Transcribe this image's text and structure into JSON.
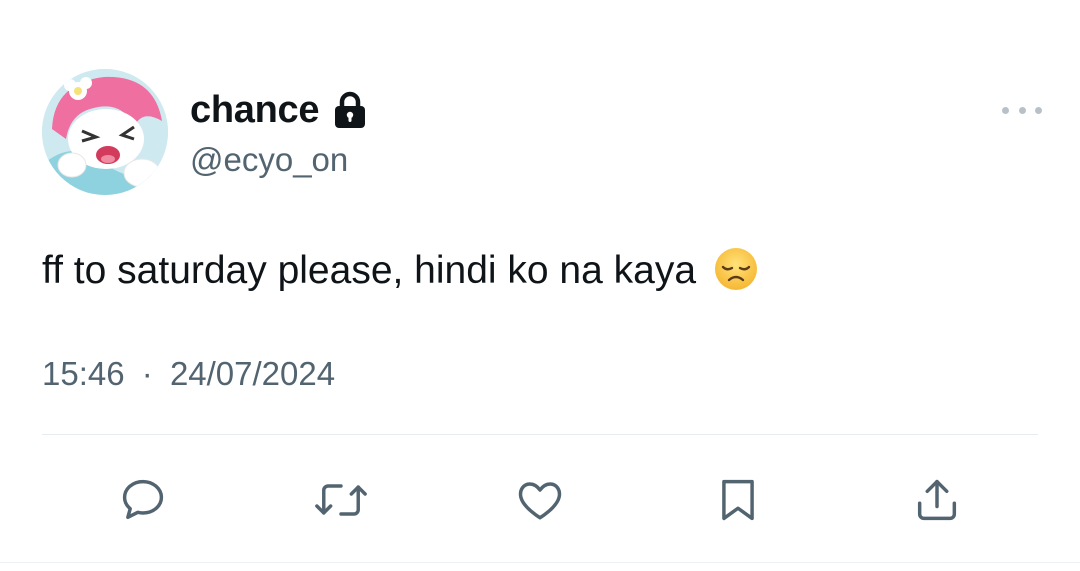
{
  "author": {
    "display_name": "chance",
    "handle": "@ecyo_on",
    "protected": true,
    "avatar": "my-melody-avatar"
  },
  "tweet": {
    "text": "ff to saturday please, hindi ko na kaya",
    "emoji": "disappointed-face-emoji",
    "time": "15:46",
    "separator": "·",
    "date": "24/07/2024"
  },
  "actions": [
    {
      "name": "reply",
      "icon": "speech-bubble-icon"
    },
    {
      "name": "retweet",
      "icon": "retweet-arrows-icon"
    },
    {
      "name": "like",
      "icon": "heart-icon"
    },
    {
      "name": "bookmark",
      "icon": "bookmark-icon"
    },
    {
      "name": "share",
      "icon": "share-upload-icon"
    }
  ],
  "colors": {
    "text_primary": "#0f1419",
    "text_secondary": "#536471",
    "icon": "#536471",
    "divider": "#e6ecf0",
    "avatar_pink": "#ee6fa0",
    "avatar_bg": "#cfe9f0"
  }
}
